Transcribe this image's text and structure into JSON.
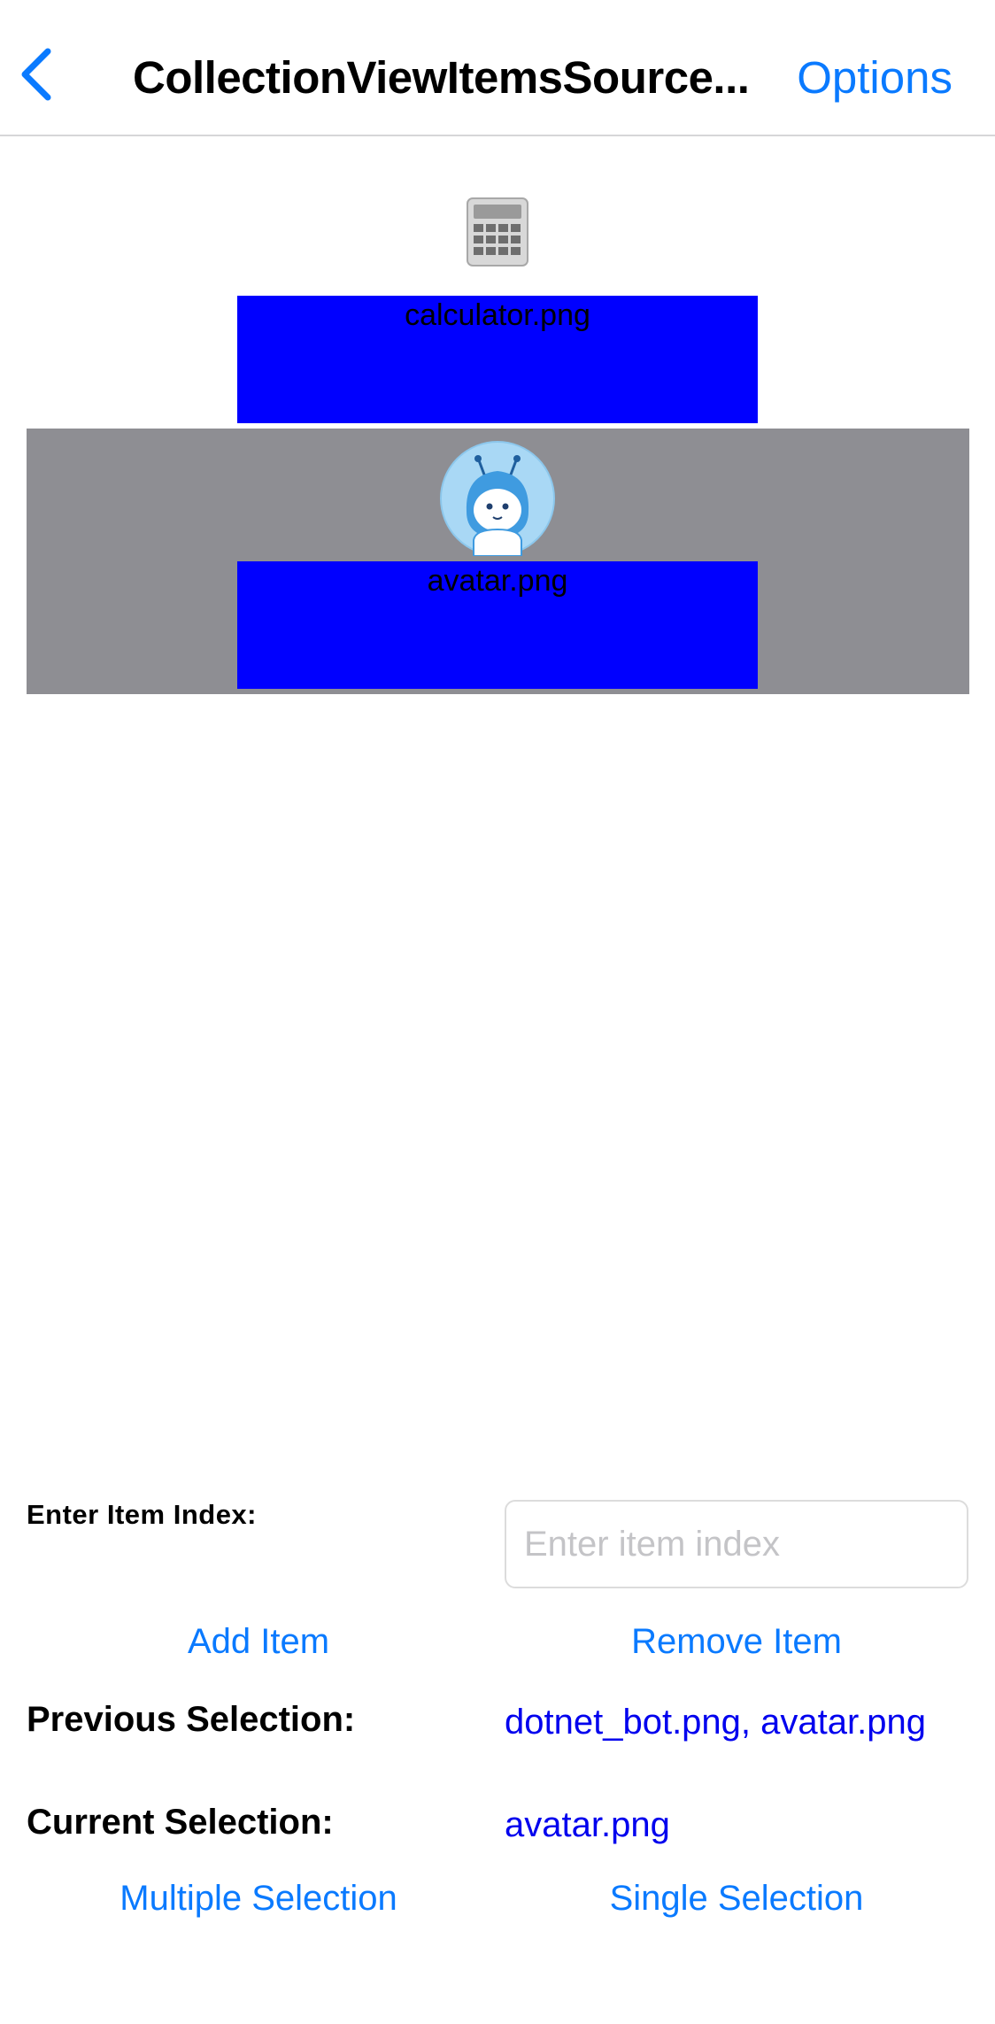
{
  "navbar": {
    "title": "CollectionViewItemsSource...",
    "options_label": "Options",
    "back_icon": "chevron-left-icon"
  },
  "colors": {
    "accent": "#0a7aff",
    "item_label_bg": "#0000ff",
    "selected_bg": "#8e8e93",
    "selection_text": "#0000ee"
  },
  "items": [
    {
      "label": "calculator.png",
      "icon": "calculator-icon",
      "selected": false
    },
    {
      "label": "avatar.png",
      "icon": "avatar-bot-icon",
      "selected": true
    }
  ],
  "index_entry": {
    "label": "Enter Item Index:",
    "placeholder": "Enter item index",
    "value": ""
  },
  "actions": {
    "add_label": "Add Item",
    "remove_label": "Remove Item",
    "multiple_label": "Multiple Selection",
    "single_label": "Single Selection"
  },
  "selection": {
    "previous_label": "Previous Selection:",
    "previous_value": "dotnet_bot.png, avatar.png",
    "current_label": "Current Selection:",
    "current_value": "avatar.png"
  }
}
